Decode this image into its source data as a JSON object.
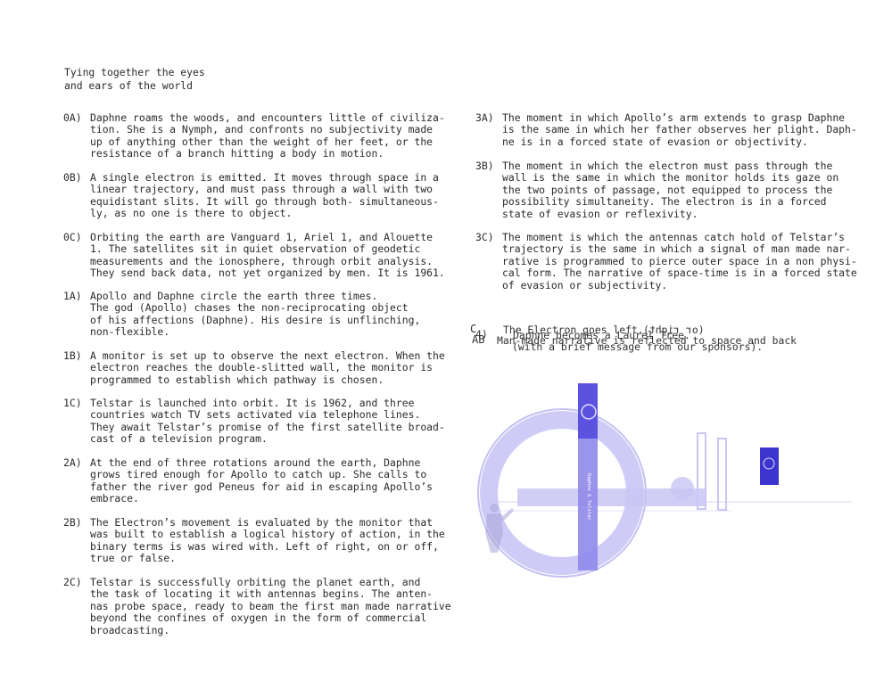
{
  "title": "Tying together the eyes\nand ears of the world",
  "left_entries": [
    {
      "label": "0A)",
      "text": "Daphne roams the woods, and encounters little of civiliza-\ntion. She is a Nymph, and confronts no subjectivity made\nup of anything other than the weight of her feet, or the\nresistance of a branch hitting a body in motion."
    },
    {
      "label": "0B)",
      "text": "A single electron is emitted. It moves through space in a\nlinear trajectory, and must pass through a wall with two\nequidistant slits. It will go through both- simultaneous-\nly, as no one is there to object."
    },
    {
      "label": "0C)",
      "text": "Orbiting the earth are Vanguard 1, Ariel 1, and Alouette\n1. The satellites sit in quiet observation of geodetic\nmeasurements and the ionosphere, through orbit analysis.\nThey send back data, not yet organized by men. It is 1961."
    },
    {
      "label": "1A)",
      "text": "Apollo and Daphne circle the earth three times.\nThe god (Apollo) chases the non-reciprocating object\nof his affections (Daphne). His desire is unflinching,\nnon-flexible."
    },
    {
      "label": "1B)",
      "text": "A monitor is set up to observe the next electron. When the\nelectron reaches the double-slitted wall, the monitor is\nprogrammed to establish which pathway is chosen."
    },
    {
      "label": "1C)",
      "text": "Telstar is launched into orbit. It is 1962, and three\ncountries watch TV sets activated via telephone lines.\nThey await Telstar’s promise of the first satellite broad-\ncast of a television program."
    },
    {
      "label": "2A)",
      "text": "At the end of three rotations around the earth, Daphne\ngrows tired enough for Apollo to catch up. She calls to\nfather the river god Peneus for aid in escaping Apollo’s\nembrace."
    },
    {
      "label": "2B)",
      "text": "The Electron’s movement is evaluated by the monitor that\nwas built to establish a logical history of action, in the\nbinary terms is was wired with. Left of right, on or off,\ntrue or false."
    },
    {
      "label": "2C)",
      "text": "Telstar is successfully orbiting the planet earth, and\nthe task of locating it with antennas begins. The anten-\nnas probe space, ready to beam the first man made narrative\nbeyond the confines of oxygen in the form of commercial\nbroadcasting."
    }
  ],
  "right_entries": [
    {
      "label": "3A)",
      "text": "The moment in which Apollo’s arm extends to grasp Daphne\nis the same in which her father observes her plight. Daph-\nne is in a forced state of evasion or objectivity."
    },
    {
      "label": "3B)",
      "text": "The moment in which the electron must pass through the\nwall is the same in which the monitor holds its gaze on\nthe two points of passage, not equipped to process the\npossibility simultaneity. The electron is in a forced\nstate of evasion or reflexivity."
    },
    {
      "label": "3C)",
      "text": "The moment is which the antennas catch hold of Telstar’s\ntrajectory is the same in which a signal of man made nar-\nrative is programmed to pierce outer space in a non physi-\ncal form. The narrative of space-time is in a forced state\nof evasion or subjectivity."
    }
  ],
  "overlay": {
    "label_c": "C",
    "label_4": "4)",
    "label_ab": "AB",
    "line_electron": "The Electron goes left.",
    "line_electron_mirror": "(or right)",
    "line_daphne": "Daphne becomes a Laurel Tree.",
    "line_narrative": "Man-made narrative is reflected to space and back",
    "line_sponsors": "(with a brief message from our sponsors).",
    "panel_caption": "Daphne &\nTelstar"
  },
  "colors": {
    "accent": "#5b52e0",
    "accent_light": "#c9c6f5",
    "text": "#2a2a2a"
  }
}
